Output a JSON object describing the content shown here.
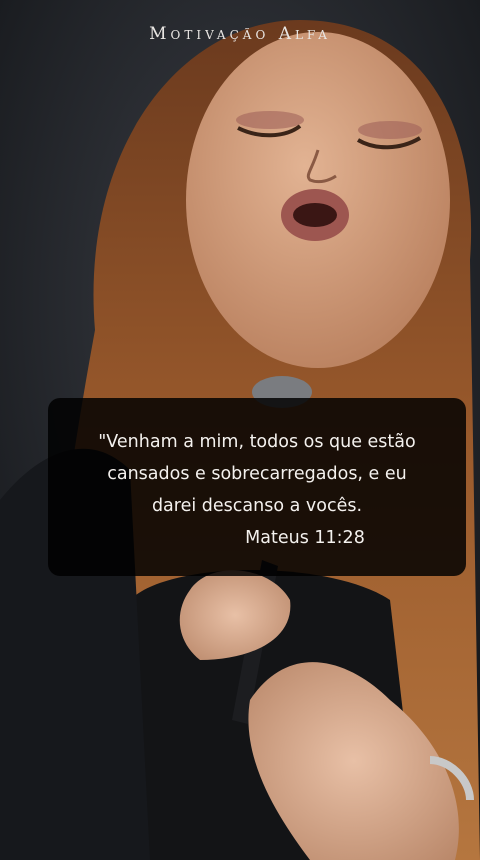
{
  "overlay": {
    "brand": "Motivação Alfa"
  },
  "quote": {
    "line1": "\"Venham a mim, todos os que estão",
    "line2": "cansados e sobrecarregados, e eu",
    "line3": "darei descanso a vocês.",
    "reference": "Mateus 11:28"
  },
  "colors": {
    "background": "#14161a",
    "card": "#000000",
    "text": "#f4f1ee",
    "hair": "#8a4c26",
    "skin": "#d6a280"
  }
}
